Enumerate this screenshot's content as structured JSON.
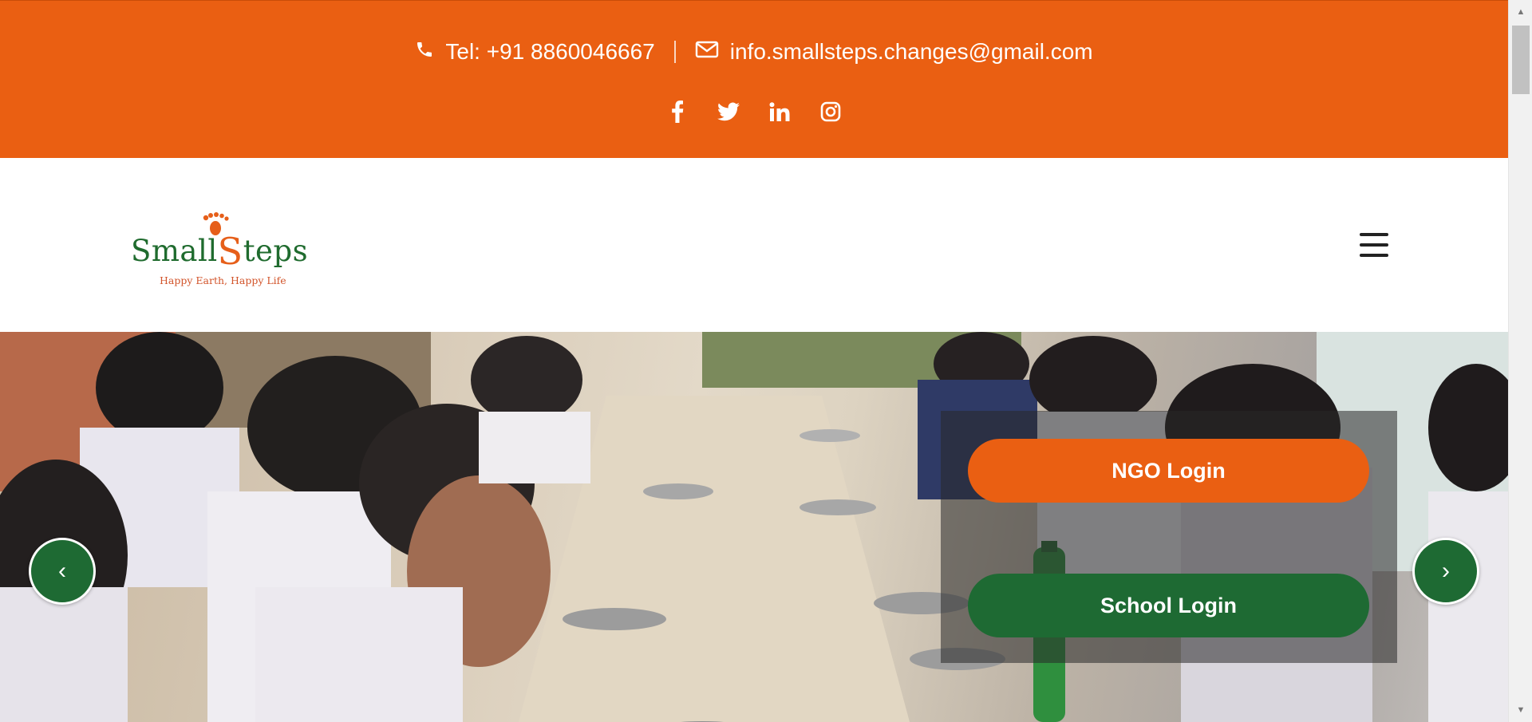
{
  "topbar": {
    "phone_text": "Tel: +91 8860046667",
    "email_text": "info.smallsteps.changes@gmail.com",
    "social": [
      "facebook-icon",
      "twitter-icon",
      "linkedin-icon",
      "instagram-icon"
    ]
  },
  "header": {
    "logo_word_pre": "Small",
    "logo_word_letter": "S",
    "logo_word_post": "teps",
    "logo_tagline": "Happy Earth, Happy Life",
    "menu_icon": "hamburger-icon"
  },
  "hero": {
    "ngo_login_label": "NGO Login",
    "school_login_label": "School Login",
    "prev_label": "‹",
    "next_label": "›"
  },
  "colors": {
    "brand_orange": "#ea5f12",
    "brand_green": "#1e6a33"
  }
}
